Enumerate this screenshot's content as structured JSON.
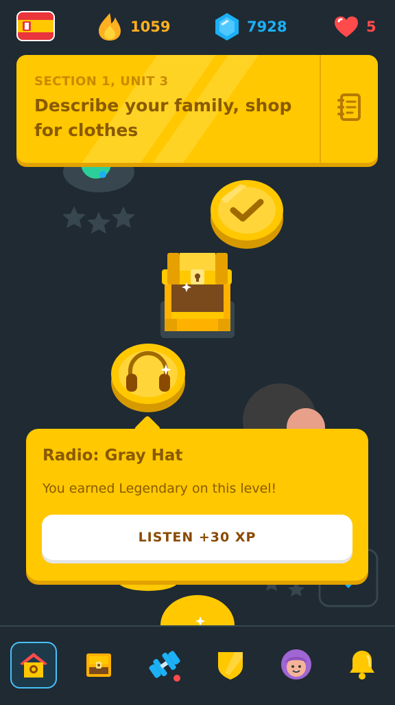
{
  "top_bar": {
    "course_flag": "spain-flag",
    "streak_count": "1059",
    "gems_count": "7928",
    "hearts_count": "5"
  },
  "unit_banner": {
    "section_label": "SECTION 1, UNIT 3",
    "title": "Describe your family, shop for clothes",
    "guide_icon": "notebook-icon"
  },
  "path": {
    "nodes": [
      {
        "type": "legendary-lesson",
        "icon": "check-icon",
        "state": "completed"
      },
      {
        "type": "chest",
        "icon": "chest-icon",
        "state": "opened"
      },
      {
        "type": "radio",
        "icon": "headphones-icon",
        "state": "legendary"
      }
    ]
  },
  "tooltip": {
    "title": "Radio: Gray Hat",
    "description": "You earned Legendary on this level!",
    "button_label": "LISTEN +30 XP"
  },
  "tab_bar": {
    "tabs": [
      {
        "name": "learn",
        "icon": "home-icon",
        "active": true
      },
      {
        "name": "stories",
        "icon": "treasure-chest-icon",
        "active": false
      },
      {
        "name": "practice",
        "icon": "dumbbell-icon",
        "active": false
      },
      {
        "name": "leaderboards",
        "icon": "shield-icon",
        "active": false
      },
      {
        "name": "profile",
        "icon": "avatar-icon",
        "active": false
      },
      {
        "name": "notifications",
        "icon": "bell-icon",
        "active": false
      }
    ]
  },
  "colors": {
    "background": "#1f2a33",
    "gold": "#ffc800",
    "gold_dark": "#8a5a00",
    "streak": "#ffb020",
    "gems": "#1cb0f6",
    "hearts": "#ff4b4b",
    "active_tab": "#49c0f8"
  }
}
